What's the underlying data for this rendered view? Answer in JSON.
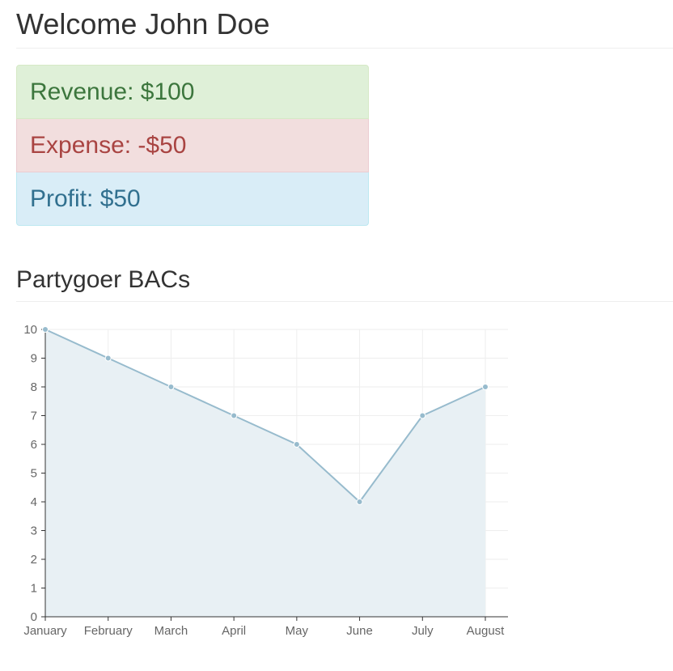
{
  "header": {
    "title": "Welcome John Doe"
  },
  "summary": {
    "revenue": "Revenue: $100",
    "expense": "Expense: -$50",
    "profit": "Profit: $50"
  },
  "section": {
    "title": "Partygoer BACs"
  },
  "colors": {
    "line": "#97bbcd",
    "fill": "#e8f0f4",
    "point": "#97bbcd",
    "grid": "#eeeeee",
    "axis": "#333333"
  },
  "chart_data": {
    "type": "line",
    "categories": [
      "January",
      "February",
      "March",
      "April",
      "May",
      "June",
      "July",
      "August"
    ],
    "values": [
      10,
      9,
      8,
      7,
      6,
      4,
      7,
      8
    ],
    "ylim": [
      0,
      10
    ],
    "yticks": [
      0,
      1,
      2,
      3,
      4,
      5,
      6,
      7,
      8,
      9,
      10
    ],
    "grid": true,
    "filled": true
  }
}
